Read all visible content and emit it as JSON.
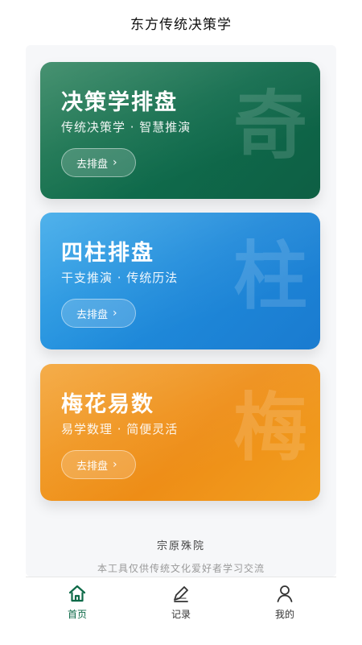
{
  "header": {
    "title": "东方传统决策学"
  },
  "cards": [
    {
      "title": "决策学排盘",
      "subtitle": "传统决策学 · 智慧推演",
      "button": "去排盘",
      "watermark": "奇",
      "accent": "#0f6a4b"
    },
    {
      "title": "四柱排盘",
      "subtitle": "干支推演 · 传统历法",
      "button": "去排盘",
      "watermark": "柱",
      "accent": "#1e88d9"
    },
    {
      "title": "梅花易数",
      "subtitle": "易学数理 · 简便灵活",
      "button": "去排盘",
      "watermark": "梅",
      "accent": "#ee8d16"
    }
  ],
  "footer": {
    "name": "宗原殊院",
    "disclaimer": "本工具仅供传统文化爱好者学习交流"
  },
  "nav": {
    "items": [
      {
        "label": "首页",
        "icon": "home-icon",
        "active": true
      },
      {
        "label": "记录",
        "icon": "edit-icon",
        "active": false
      },
      {
        "label": "我的",
        "icon": "user-icon",
        "active": false
      }
    ],
    "active_color": "#0e6a48"
  }
}
